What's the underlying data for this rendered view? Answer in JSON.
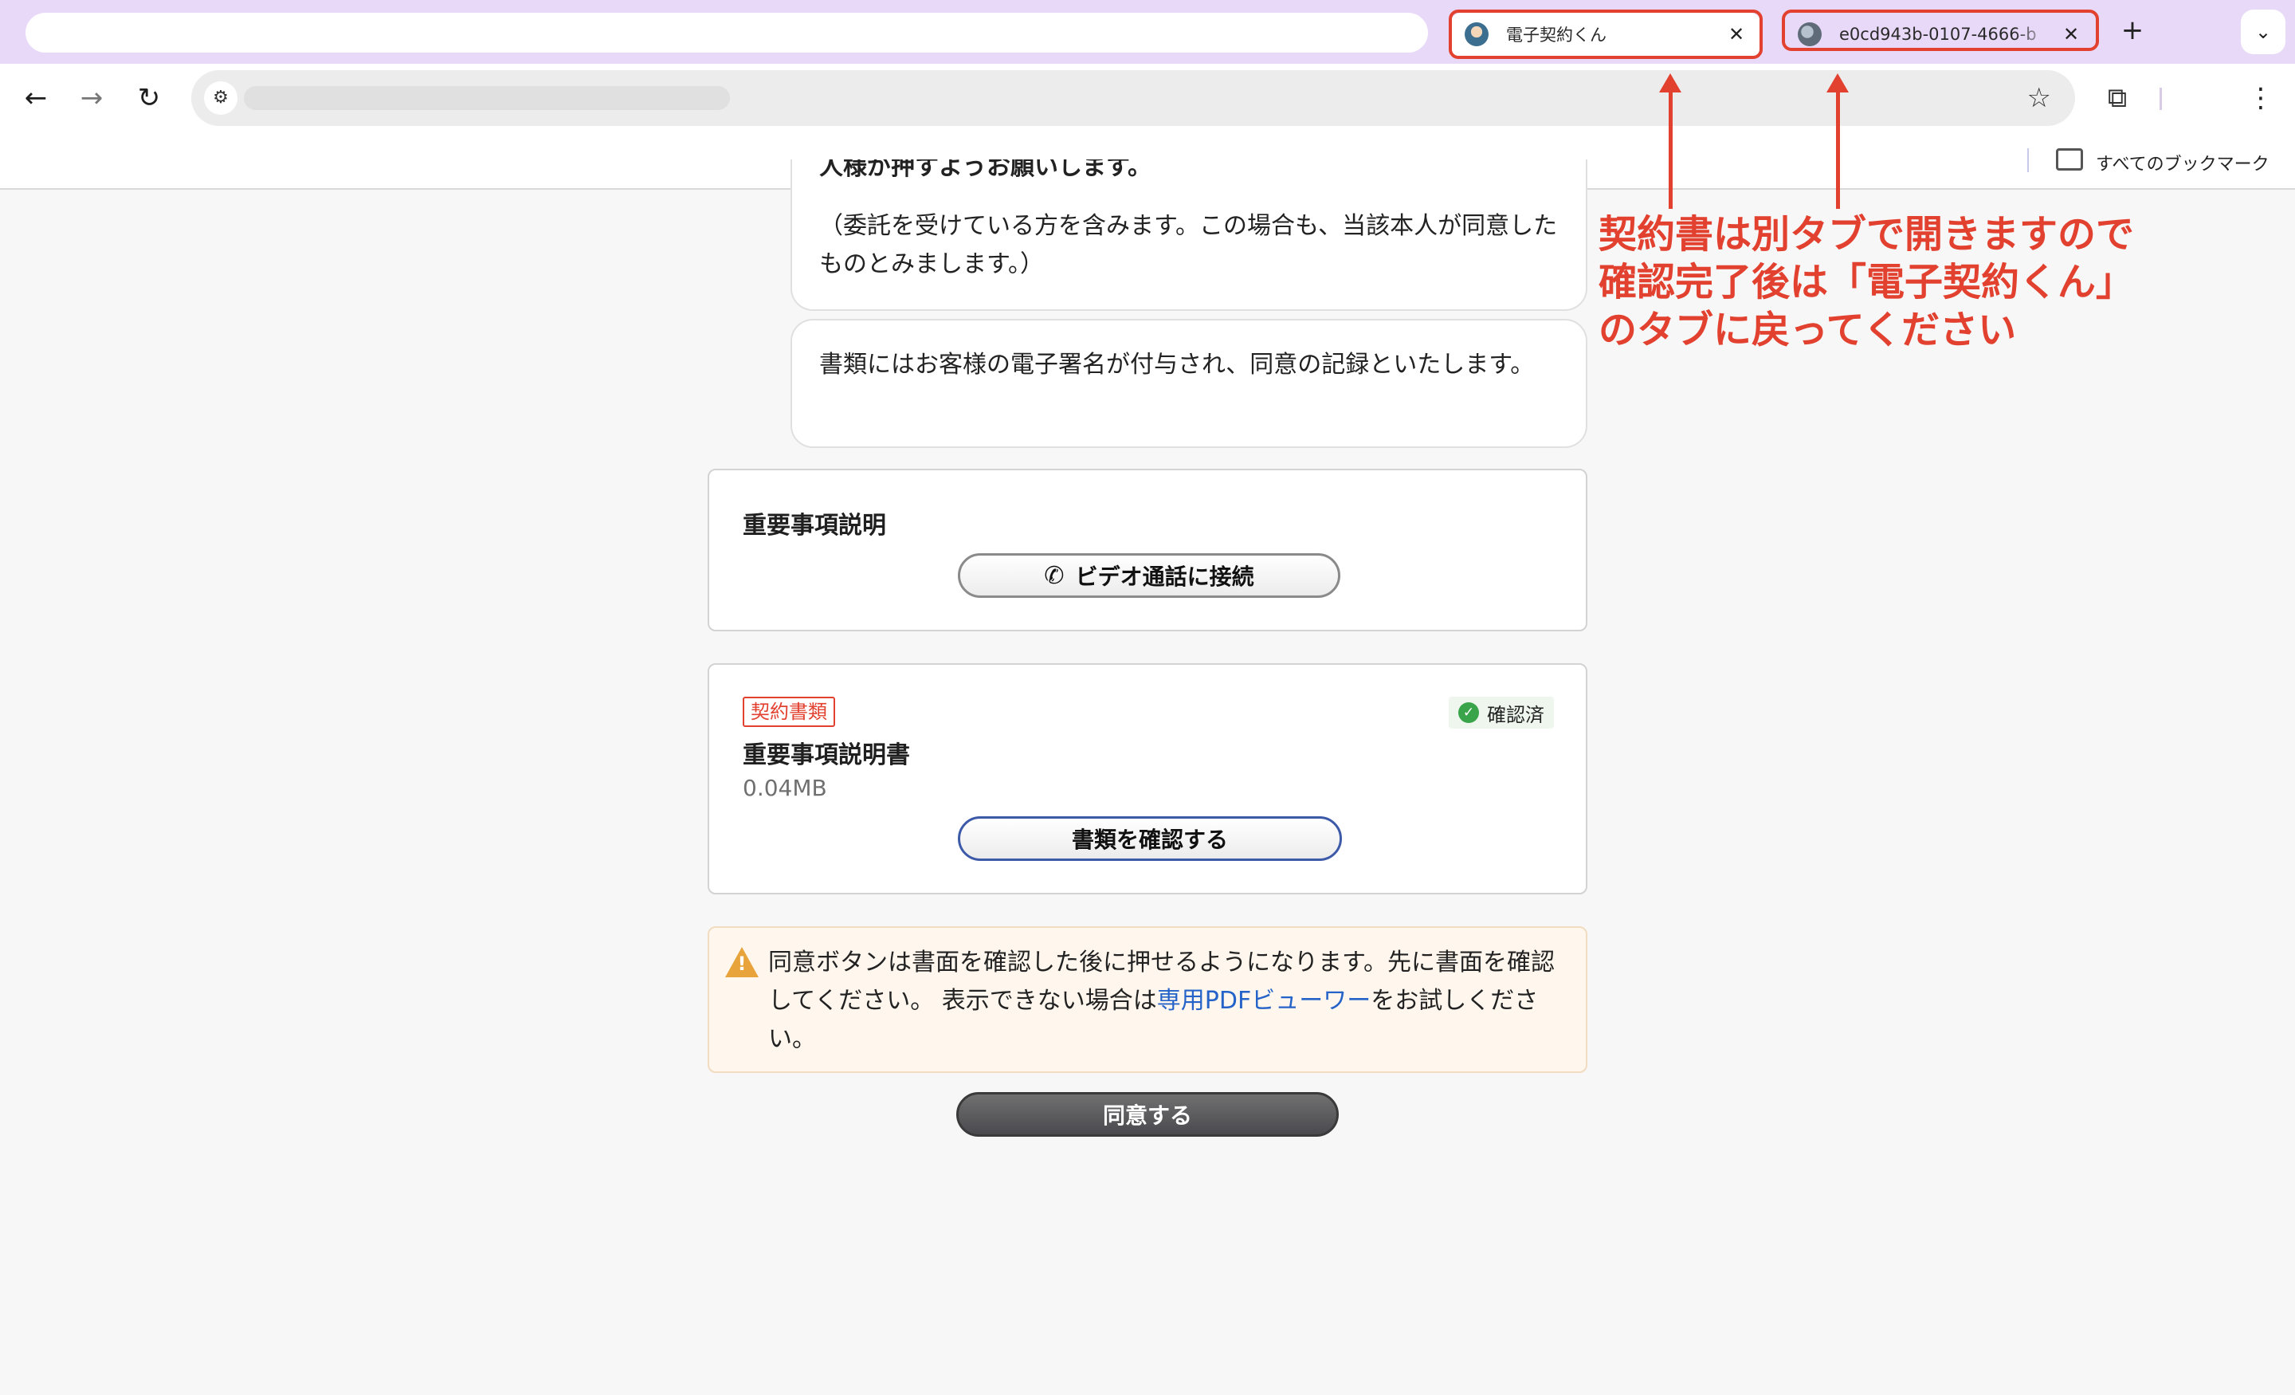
{
  "browser": {
    "tabs": [
      {
        "title": "電子契約くん",
        "active": true
      },
      {
        "title": "e0cd943b-0107-4666-b",
        "active": false
      }
    ],
    "new_tab_glyph": "+",
    "tab_list_glyph": "⌄",
    "bookmarks": {
      "all_bookmarks_label": "すべてのブックマーク"
    },
    "icons": [
      "back-icon",
      "forward-icon",
      "reload-icon",
      "site-info-icon",
      "star-icon",
      "extensions-icon",
      "menu-icon",
      "folder-icon"
    ]
  },
  "chat": {
    "bubble1_cut_line": "人様が押すようお願いします。",
    "bubble1_text": "（委託を受けている方を含みます。この場合も、当該本人が同意したものとみまします。）",
    "bubble2_text": "書類にはお客様の電子署名が付与され、同意の記録といたします。"
  },
  "important_section": {
    "title": "重要事項説明",
    "video_button_label": "ビデオ通話に接続"
  },
  "document": {
    "tag": "契約書類",
    "status": "確認済",
    "title": "重要事項説明書",
    "size": "0.04MB",
    "confirm_button_label": "書類を確認する"
  },
  "warning": {
    "text_before_link": "同意ボタンは書面を確認した後に押せるようになります。先に書面を確認してください。 表示できない場合は",
    "link_text": "専用PDFビューワー",
    "text_after_link": "をお試しください。"
  },
  "agree_button_label": "同意する",
  "annotation": {
    "lines": [
      "契約書は別タブで開きますので",
      "確認完了後は「電子契約くん」",
      "のタブに戻ってください"
    ]
  },
  "colors": {
    "annotation_red": "#e2412f",
    "tabstrip": "#e9d9f8",
    "link_blue": "#2563c8",
    "confirmed_green": "#3aa44a",
    "warning_icon": "#e8a33a"
  }
}
